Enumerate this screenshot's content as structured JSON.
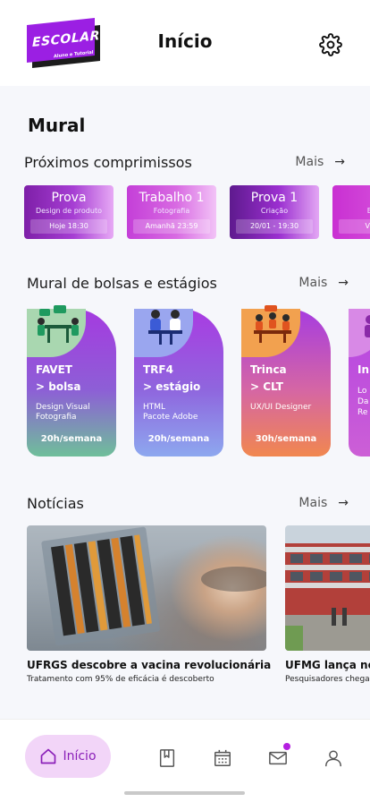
{
  "header": {
    "logo_text": "ESCOLAR",
    "logo_tagline": "Aluno e Tutorial",
    "title": "Início",
    "settings_icon": "gear-icon"
  },
  "mural": {
    "title": "Mural",
    "commitments": {
      "label": "Próximos comprimissos",
      "more": "Mais",
      "items": [
        {
          "title": "Prova",
          "subtitle": "Design de produto",
          "time": "Hoje 18:30"
        },
        {
          "title": "Trabalho 1",
          "subtitle": "Fotografia",
          "time": "Amanhã 23:59"
        },
        {
          "title": "Prova 1",
          "subtitle": "Criação",
          "time": "20/01 - 19:30"
        },
        {
          "title": "C",
          "subtitle": "Estud",
          "time": "View C"
        }
      ]
    },
    "opportunities": {
      "label": "Mural de bolsas e estágios",
      "more": "Mais",
      "items": [
        {
          "company": "FAVET",
          "type": "> bolsa",
          "line1": "Design Visual",
          "line2": "Fotografia",
          "hours": "20h/semana"
        },
        {
          "company": "TRF4",
          "type": "> estágio",
          "line1": "HTML",
          "line2": "Pacote Adobe",
          "hours": "20h/semana"
        },
        {
          "company": "Trinca",
          "type": "> CLT",
          "line1": "UX/UI Designer",
          "line2": "",
          "hours": "30h/semana"
        },
        {
          "company": "In",
          "type": "",
          "line1": "Lo",
          "line2": "Da",
          "line3": "Re",
          "hours": ""
        }
      ]
    }
  },
  "news": {
    "label": "Notícias",
    "more": "Mais",
    "items": [
      {
        "title": "UFRGS descobre a vacina revolucionária",
        "subtitle": "Tratamento com 95% de eficácia é descoberto"
      },
      {
        "title": "UFMG lança nov",
        "subtitle": "Pesquisadores chega"
      }
    ]
  },
  "nav": {
    "home": "Início",
    "icons": [
      "home-icon",
      "bookmark-icon",
      "calendar-icon",
      "mail-icon",
      "profile-icon"
    ]
  },
  "colors": {
    "accent": "#9b1fe3",
    "nav_active_bg": "#f2d5f8",
    "notification_dot": "#b41fe0"
  }
}
